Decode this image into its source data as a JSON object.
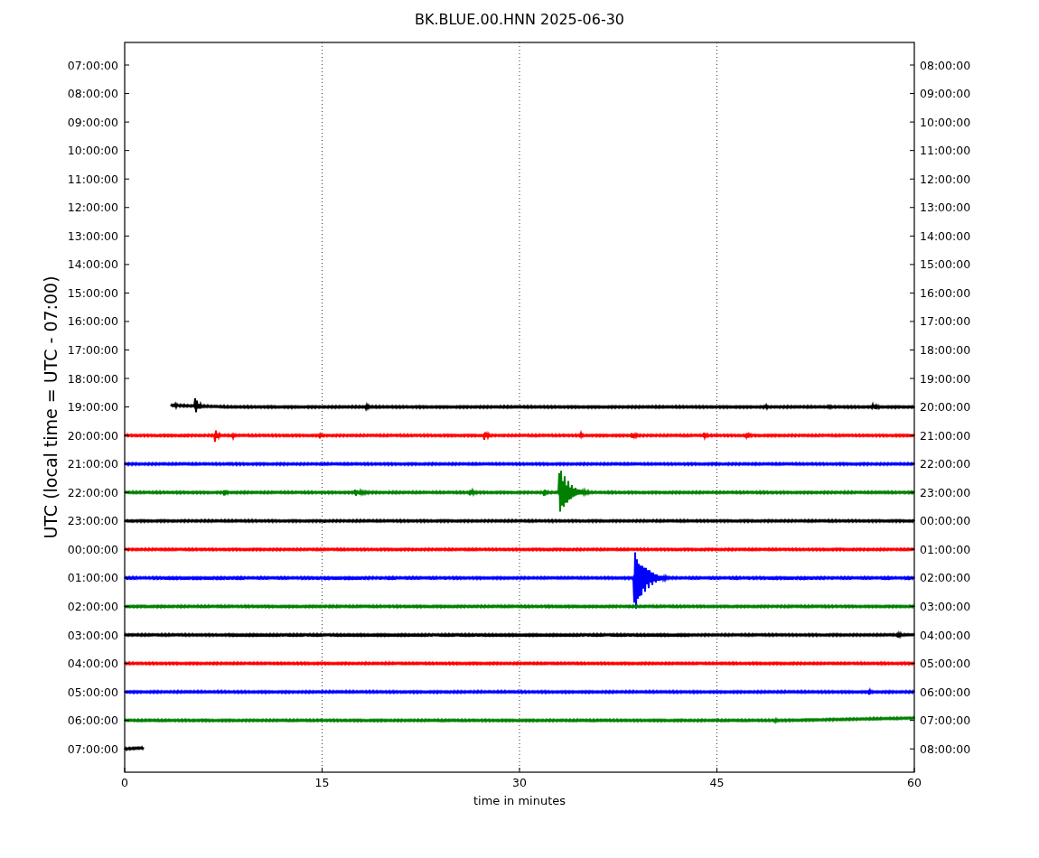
{
  "title": "BK.BLUE.00.HNN 2025-06-30",
  "ylabel": "UTC (local time = UTC - 07:00)",
  "xlabel": "time in minutes",
  "xticks": [
    "0",
    "15",
    "30",
    "45",
    "60"
  ],
  "left_labels": [
    "07:00:00",
    "08:00:00",
    "09:00:00",
    "10:00:00",
    "11:00:00",
    "12:00:00",
    "13:00:00",
    "14:00:00",
    "15:00:00",
    "16:00:00",
    "17:00:00",
    "18:00:00",
    "19:00:00",
    "20:00:00",
    "21:00:00",
    "22:00:00",
    "23:00:00",
    "00:00:00",
    "01:00:00",
    "02:00:00",
    "03:00:00",
    "04:00:00",
    "05:00:00",
    "06:00:00",
    "07:00:00"
  ],
  "right_labels": [
    "08:00:00",
    "09:00:00",
    "10:00:00",
    "11:00:00",
    "12:00:00",
    "13:00:00",
    "14:00:00",
    "15:00:00",
    "16:00:00",
    "17:00:00",
    "18:00:00",
    "19:00:00",
    "20:00:00",
    "21:00:00",
    "22:00:00",
    "23:00:00",
    "00:00:00",
    "01:00:00",
    "02:00:00",
    "03:00:00",
    "04:00:00",
    "05:00:00",
    "06:00:00",
    "07:00:00",
    "08:00:00"
  ],
  "traces": [
    {
      "kind": "late-start",
      "color": "#000000"
    },
    {
      "kind": "full",
      "color": "#ff0000"
    },
    {
      "kind": "full",
      "color": "#0000ff"
    },
    {
      "kind": "full",
      "color": "#008000"
    },
    {
      "kind": "full",
      "color": "#000000"
    },
    {
      "kind": "full",
      "color": "#ff0000"
    },
    {
      "kind": "full",
      "color": "#0000ff"
    },
    {
      "kind": "full",
      "color": "#008000"
    },
    {
      "kind": "full",
      "color": "#000000"
    },
    {
      "kind": "full",
      "color": "#ff0000"
    },
    {
      "kind": "full",
      "color": "#0000ff"
    },
    {
      "kind": "full",
      "color": "#008000"
    },
    {
      "kind": "early-end",
      "color": "#000000"
    }
  ]
}
